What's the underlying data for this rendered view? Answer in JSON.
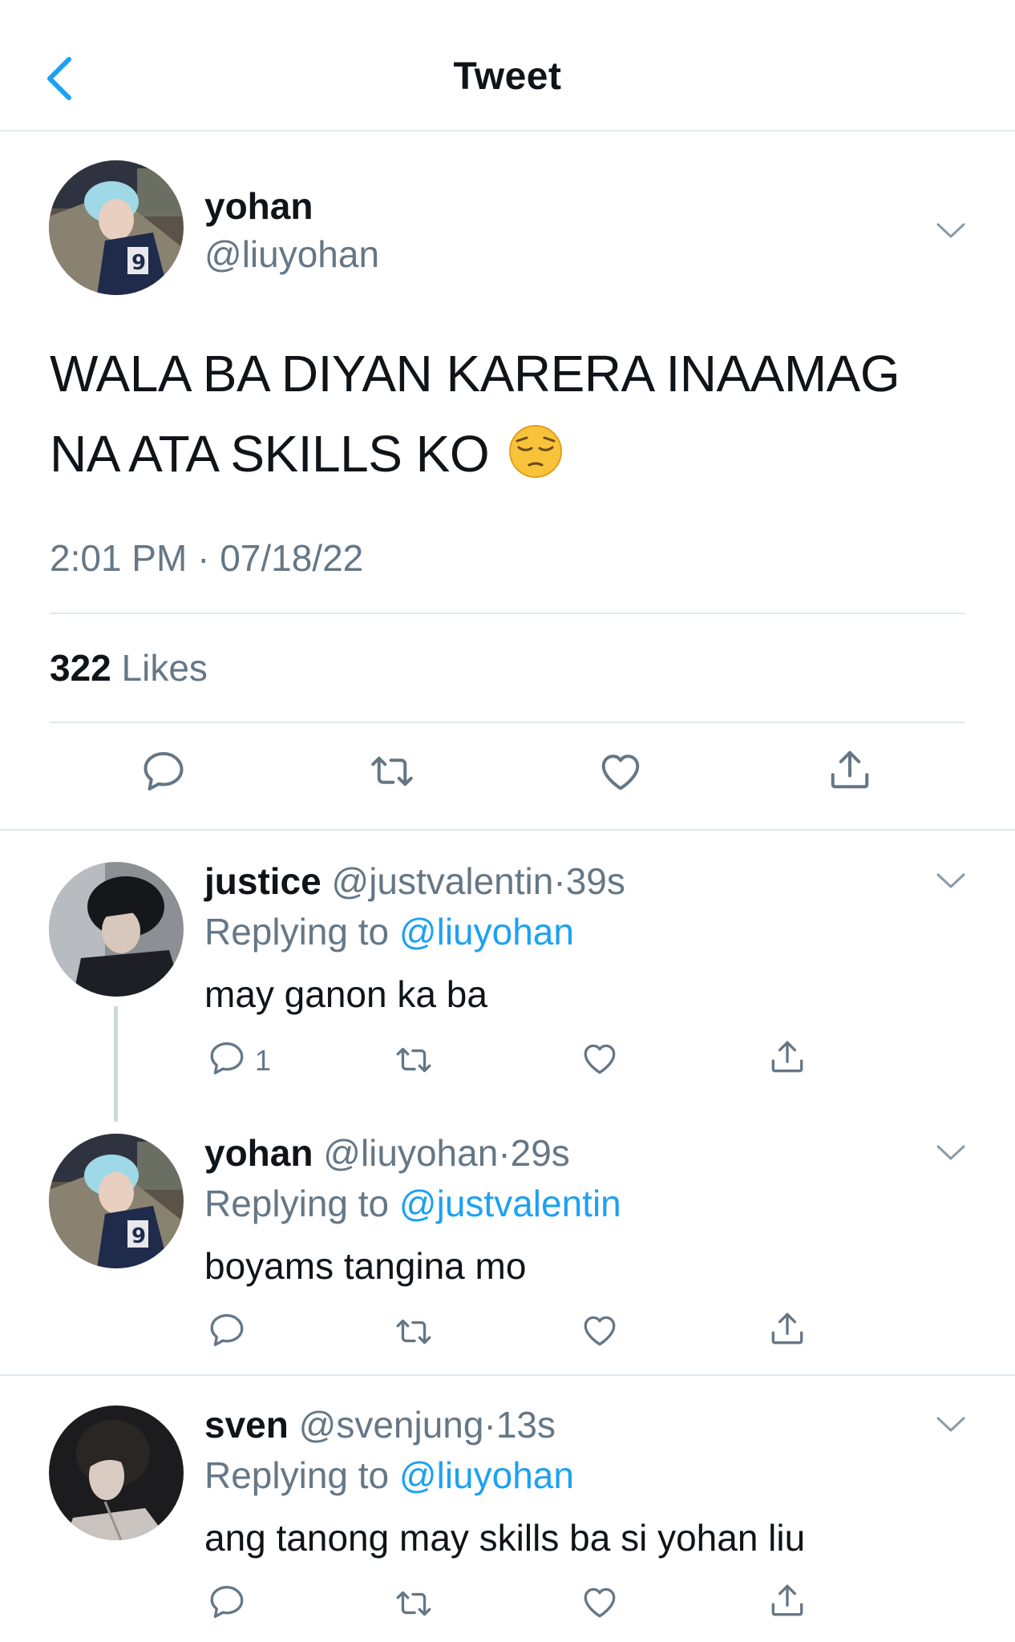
{
  "header": {
    "title": "Tweet",
    "back_icon": "chevron-left-icon",
    "accent": "#1da1f2"
  },
  "main_tweet": {
    "display_name": "yohan",
    "handle": "@liuyohan",
    "text": "WALA BA DIYAN KARERA INAAMAG NA ATA SKILLS KO",
    "emoji": "pensive-face-emoji",
    "timestamp": "2:01 PM · 07/18/22",
    "likes_count": "322",
    "likes_label": "Likes",
    "actions": [
      "reply-icon",
      "retweet-icon",
      "like-icon",
      "share-icon"
    ]
  },
  "replies": [
    {
      "display_name": "justice",
      "handle": "@justvalentin",
      "time": "39s",
      "replying_prefix": "Replying to",
      "replying_to": "@liuyohan",
      "text": "may ganon ka ba",
      "reply_count": "1"
    },
    {
      "display_name": "yohan",
      "handle": "@liuyohan",
      "time": "29s",
      "replying_prefix": "Replying to",
      "replying_to": "@justvalentin",
      "text": "boyams tangina mo",
      "reply_count": ""
    },
    {
      "display_name": "sven",
      "handle": "@svenjung",
      "time": "13s",
      "replying_prefix": "Replying to",
      "replying_to": "@liuyohan",
      "text": "ang tanong may skills ba si yohan liu",
      "reply_count": ""
    }
  ],
  "colors": {
    "text": "#0f1419",
    "secondary": "#657786",
    "link": "#1da1f2",
    "divider": "#e1e8ed",
    "icon": "#657786"
  }
}
